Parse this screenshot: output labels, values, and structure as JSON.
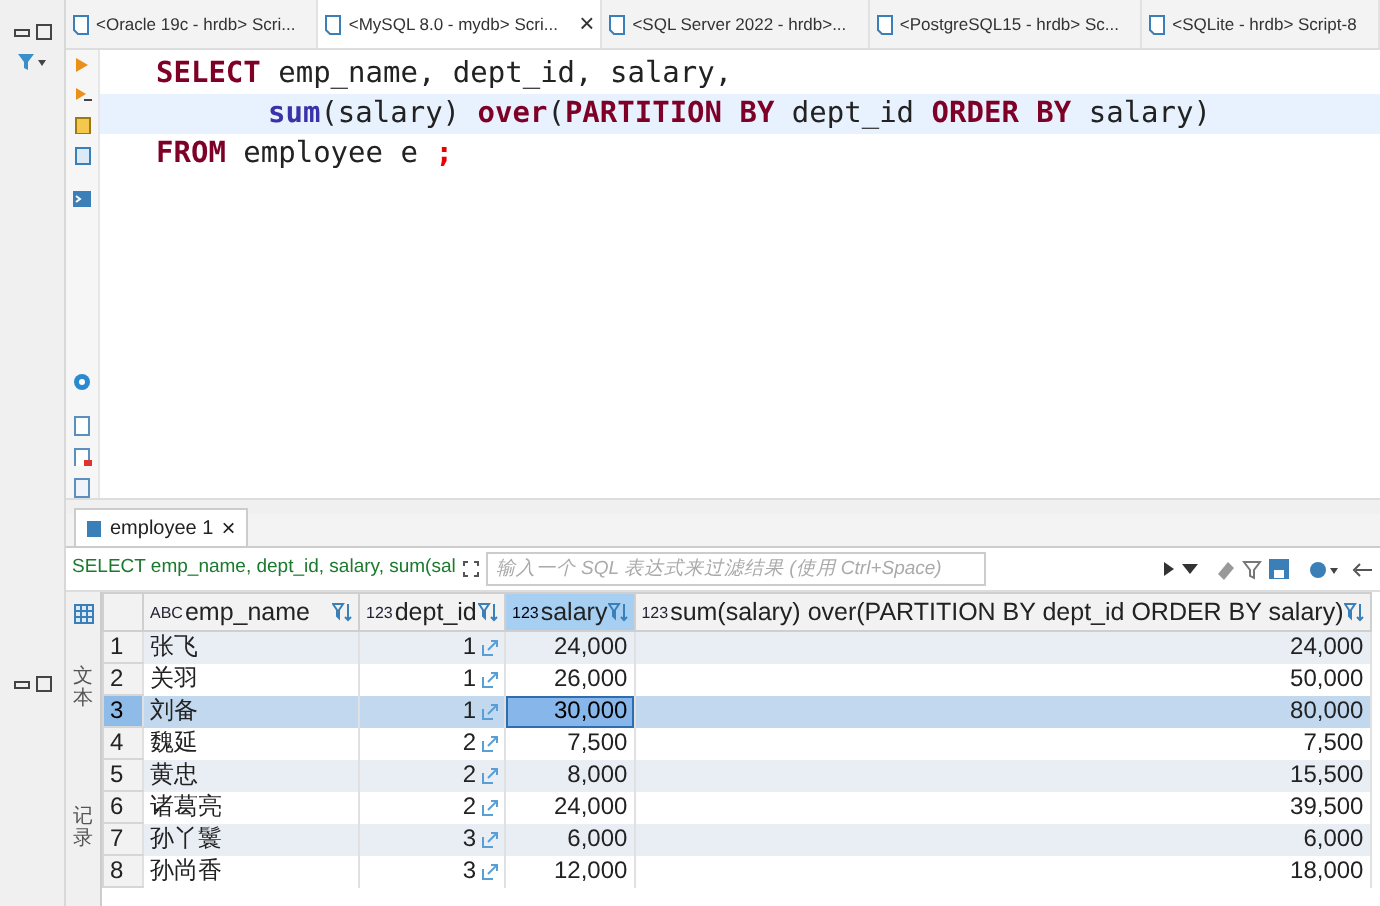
{
  "editor_tabs": [
    {
      "label": "<Oracle 19c - hrdb> Scri...",
      "selected": false
    },
    {
      "label": "<MySQL 8.0 - mydb> Scri...",
      "selected": true,
      "close": "×"
    },
    {
      "label": "<SQL Server 2022 - hrdb>...",
      "selected": false
    },
    {
      "label": "<PostgreSQL15 - hrdb> Sc...",
      "selected": false
    },
    {
      "label": "<SQLite - hrdb> Script-8",
      "selected": false
    }
  ],
  "code_lines": [
    {
      "current": false,
      "indent": false,
      "tokens": [
        {
          "kind": "keyword",
          "text": "SELECT"
        },
        {
          "kind": "plain",
          "text": " emp_name, dept_id, salary,"
        }
      ]
    },
    {
      "current": true,
      "indent": true,
      "tokens": [
        {
          "kind": "function",
          "text": "sum"
        },
        {
          "kind": "plain",
          "text": "(salary) "
        },
        {
          "kind": "keyword",
          "text": "over"
        },
        {
          "kind": "plain",
          "text": "("
        },
        {
          "kind": "keyword",
          "text": "PARTITION BY"
        },
        {
          "kind": "plain",
          "text": " dept_id "
        },
        {
          "kind": "keyword",
          "text": "ORDER BY"
        },
        {
          "kind": "plain",
          "text": " salary)"
        }
      ]
    },
    {
      "current": false,
      "indent": false,
      "tokens": [
        {
          "kind": "keyword",
          "text": "FROM"
        },
        {
          "kind": "plain",
          "text": " employee e "
        },
        {
          "kind": "semicolon",
          "text": ";"
        }
      ]
    }
  ],
  "result_tab": {
    "label": "employee 1",
    "close": "×"
  },
  "filter": {
    "query": "SELECT emp_name, dept_id, salary, sum(sal",
    "placeholder": "输入一个 SQL 表达式来过滤结果 (使用 Ctrl+Space)"
  },
  "side_labels": [
    "文本",
    "记录"
  ],
  "columns": [
    {
      "name": "emp_name",
      "type": "ABC",
      "selected": false
    },
    {
      "name": "dept_id",
      "type": "123",
      "selected": false
    },
    {
      "name": "salary",
      "type": "123",
      "selected": true
    },
    {
      "name": "sum(salary) over(PARTITION BY dept_id ORDER BY salary)",
      "type": "123",
      "selected": false
    }
  ],
  "rows": [
    {
      "num": "1",
      "selected": false,
      "cells": [
        {
          "text": "张飞",
          "selected": false
        },
        {
          "text": "1",
          "selected": false
        },
        {
          "text": "24,000",
          "selected": false
        },
        {
          "text": "24,000",
          "selected": false
        }
      ]
    },
    {
      "num": "2",
      "selected": false,
      "cells": [
        {
          "text": "关羽",
          "selected": false
        },
        {
          "text": "1",
          "selected": false
        },
        {
          "text": "26,000",
          "selected": false
        },
        {
          "text": "50,000",
          "selected": false
        }
      ]
    },
    {
      "num": "3",
      "selected": true,
      "cells": [
        {
          "text": "刘备",
          "selected": false
        },
        {
          "text": "1",
          "selected": false
        },
        {
          "text": "30,000",
          "selected": true
        },
        {
          "text": "80,000",
          "selected": false
        }
      ]
    },
    {
      "num": "4",
      "selected": false,
      "cells": [
        {
          "text": "魏延",
          "selected": false
        },
        {
          "text": "2",
          "selected": false
        },
        {
          "text": "7,500",
          "selected": false
        },
        {
          "text": "7,500",
          "selected": false
        }
      ]
    },
    {
      "num": "5",
      "selected": false,
      "cells": [
        {
          "text": "黄忠",
          "selected": false
        },
        {
          "text": "2",
          "selected": false
        },
        {
          "text": "8,000",
          "selected": false
        },
        {
          "text": "15,500",
          "selected": false
        }
      ]
    },
    {
      "num": "6",
      "selected": false,
      "cells": [
        {
          "text": "诸葛亮",
          "selected": false
        },
        {
          "text": "2",
          "selected": false
        },
        {
          "text": "24,000",
          "selected": false
        },
        {
          "text": "39,500",
          "selected": false
        }
      ]
    },
    {
      "num": "7",
      "selected": false,
      "cells": [
        {
          "text": "孙丫鬟",
          "selected": false
        },
        {
          "text": "3",
          "selected": false
        },
        {
          "text": "6,000",
          "selected": false
        },
        {
          "text": "6,000",
          "selected": false
        }
      ]
    },
    {
      "num": "8",
      "selected": false,
      "cells": [
        {
          "text": "孙尚香",
          "selected": false
        },
        {
          "text": "3",
          "selected": false
        },
        {
          "text": "12,000",
          "selected": false
        },
        {
          "text": "18,000",
          "selected": false
        }
      ]
    }
  ]
}
